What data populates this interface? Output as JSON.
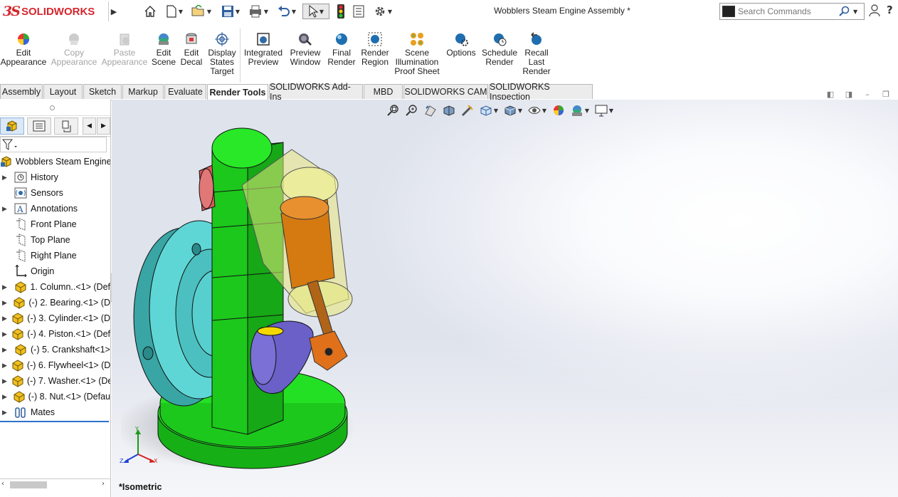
{
  "app": {
    "logo_mark": "3S",
    "logo_text": "SOLIDWORKS",
    "document_title": "Wobblers Steam Engine Assembly *"
  },
  "quick_access": {
    "icons": [
      "home-icon",
      "new-document-icon",
      "open-folder-icon",
      "save-icon",
      "print-icon",
      "undo-icon",
      "select-icon",
      "rebuild-traffic-light-icon",
      "file-properties-icon",
      "options-gear-icon"
    ]
  },
  "search": {
    "placeholder": "Search Commands"
  },
  "commands": [
    {
      "label": "Edit\nAppearance",
      "enabled": true
    },
    {
      "label": "Copy\nAppearance",
      "enabled": false
    },
    {
      "label": "Paste\nAppearance",
      "enabled": false
    },
    {
      "label": "Edit\nScene",
      "enabled": true
    },
    {
      "label": "Edit\nDecal",
      "enabled": true
    },
    {
      "label": "Display\nStates\nTarget",
      "enabled": true
    },
    {
      "label": "Integrated\nPreview",
      "enabled": true
    },
    {
      "label": "Preview\nWindow",
      "enabled": true
    },
    {
      "label": "Final\nRender",
      "enabled": true
    },
    {
      "label": "Render\nRegion",
      "enabled": true
    },
    {
      "label": "Scene\nIllumination\nProof Sheet",
      "enabled": true
    },
    {
      "label": "Options",
      "enabled": true
    },
    {
      "label": "Schedule\nRender",
      "enabled": true
    },
    {
      "label": "Recall\nLast\nRender",
      "enabled": true
    }
  ],
  "tabs": [
    {
      "label": "Assembly",
      "active": false
    },
    {
      "label": "Layout",
      "active": false
    },
    {
      "label": "Sketch",
      "active": false
    },
    {
      "label": "Markup",
      "active": false
    },
    {
      "label": "Evaluate",
      "active": false
    },
    {
      "label": "Render Tools",
      "active": true
    },
    {
      "label": "SOLIDWORKS Add-Ins",
      "active": false
    },
    {
      "label": "MBD",
      "active": false
    },
    {
      "label": "SOLIDWORKS CAM",
      "active": false
    },
    {
      "label": "SOLIDWORKS Inspection",
      "active": false
    }
  ],
  "tree": {
    "root": "Wobblers Steam Engine A",
    "items": [
      {
        "label": "History",
        "icon": "history-icon",
        "expandable": true
      },
      {
        "label": "Sensors",
        "icon": "sensors-icon",
        "expandable": false
      },
      {
        "label": "Annotations",
        "icon": "annotations-icon",
        "expandable": true
      },
      {
        "label": "Front Plane",
        "icon": "plane-icon",
        "expandable": false
      },
      {
        "label": "Top Plane",
        "icon": "plane-icon",
        "expandable": false
      },
      {
        "label": "Right Plane",
        "icon": "plane-icon",
        "expandable": false
      },
      {
        "label": "Origin",
        "icon": "origin-icon",
        "expandable": false
      },
      {
        "label": "1. Column..<1> (Def",
        "icon": "part-icon",
        "expandable": true
      },
      {
        "label": "(-) 2. Bearing.<1> (D",
        "icon": "part-icon",
        "expandable": true
      },
      {
        "label": "(-) 3. Cylinder.<1> (D",
        "icon": "part-icon",
        "expandable": true
      },
      {
        "label": "(-) 4. Piston.<1> (Def",
        "icon": "part-icon",
        "expandable": true
      },
      {
        "label": "(-) 5. Crankshaft<1>",
        "icon": "part-icon",
        "expandable": true
      },
      {
        "label": "(-) 6. Flywheel<1> (D",
        "icon": "part-icon",
        "expandable": true
      },
      {
        "label": "(-) 7. Washer.<1> (De",
        "icon": "part-icon",
        "expandable": true
      },
      {
        "label": "(-) 8. Nut.<1> (Defau",
        "icon": "part-icon",
        "expandable": true
      },
      {
        "label": "Mates",
        "icon": "mates-icon",
        "expandable": true
      }
    ]
  },
  "viewport": {
    "view_name": "*Isometric",
    "triad": {
      "x": "X",
      "y": "Y",
      "z": "Z"
    }
  },
  "colors": {
    "brand_red": "#d6262c",
    "column_green": "#22e022",
    "flywheel_cyan": "#5fd6d6",
    "piston_orange": "#e07a10",
    "crank_purple": "#7a70d6",
    "cylinder_yellow": "#e8e880"
  }
}
